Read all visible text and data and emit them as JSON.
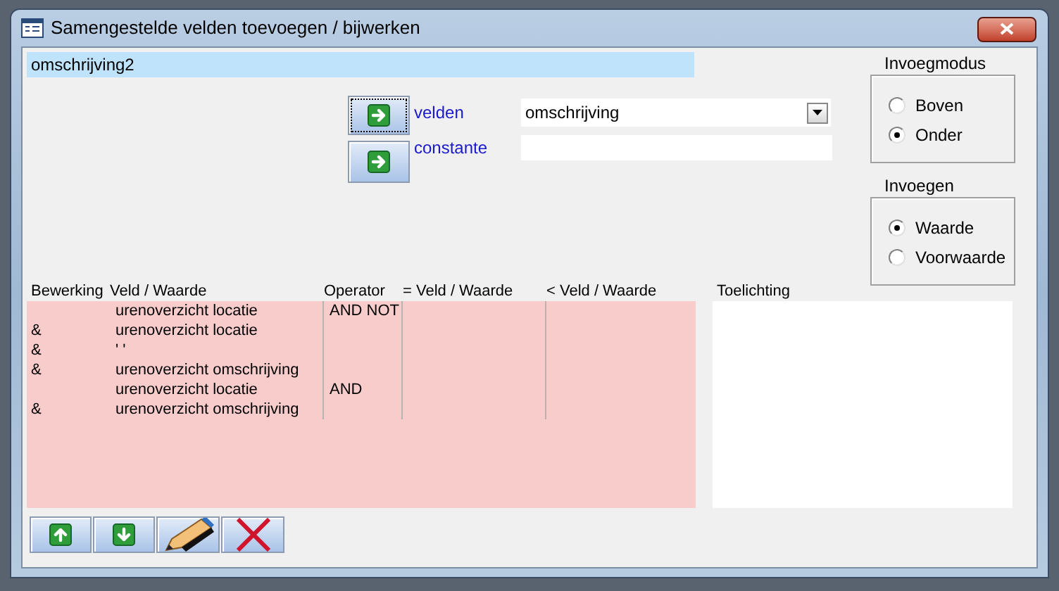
{
  "window": {
    "title": "Samengestelde velden toevoegen / bijwerken"
  },
  "name_field": {
    "value": "omschrijving2"
  },
  "sources": [
    {
      "label": "velden",
      "kind": "dropdown",
      "value": "omschrijving",
      "focused": true
    },
    {
      "label": "constante",
      "kind": "text",
      "focused": false
    }
  ],
  "groups": [
    {
      "title": "Invoegmodus",
      "options": [
        {
          "label": "Boven",
          "selected": false
        },
        {
          "label": "Onder",
          "selected": true
        }
      ]
    },
    {
      "title": "Invoegen",
      "options": [
        {
          "label": "Waarde",
          "selected": true
        },
        {
          "label": "Voorwaarde",
          "selected": false
        }
      ]
    }
  ],
  "table": {
    "columns": [
      "Bewerking",
      "Veld / Waarde",
      "Operator",
      "= Veld / Waarde",
      "< Veld / Waarde"
    ],
    "rows": [
      [
        null,
        "urenoverzicht locatie",
        "AND NOT",
        null,
        null
      ],
      [
        "&",
        "urenoverzicht locatie",
        null,
        null,
        null
      ],
      [
        "&",
        "' '",
        null,
        null,
        null
      ],
      [
        "&",
        "urenoverzicht omschrijving",
        null,
        null,
        null
      ],
      [
        null,
        "urenoverzicht locatie",
        "AND",
        null,
        null
      ],
      [
        "&",
        "urenoverzicht omschrijving",
        null,
        null,
        null
      ]
    ]
  },
  "notes": {
    "label": "Toelichting"
  },
  "toolbar": [
    {
      "kind": "up"
    },
    {
      "kind": "down"
    },
    {
      "kind": "edit"
    },
    {
      "kind": "delete"
    }
  ]
}
